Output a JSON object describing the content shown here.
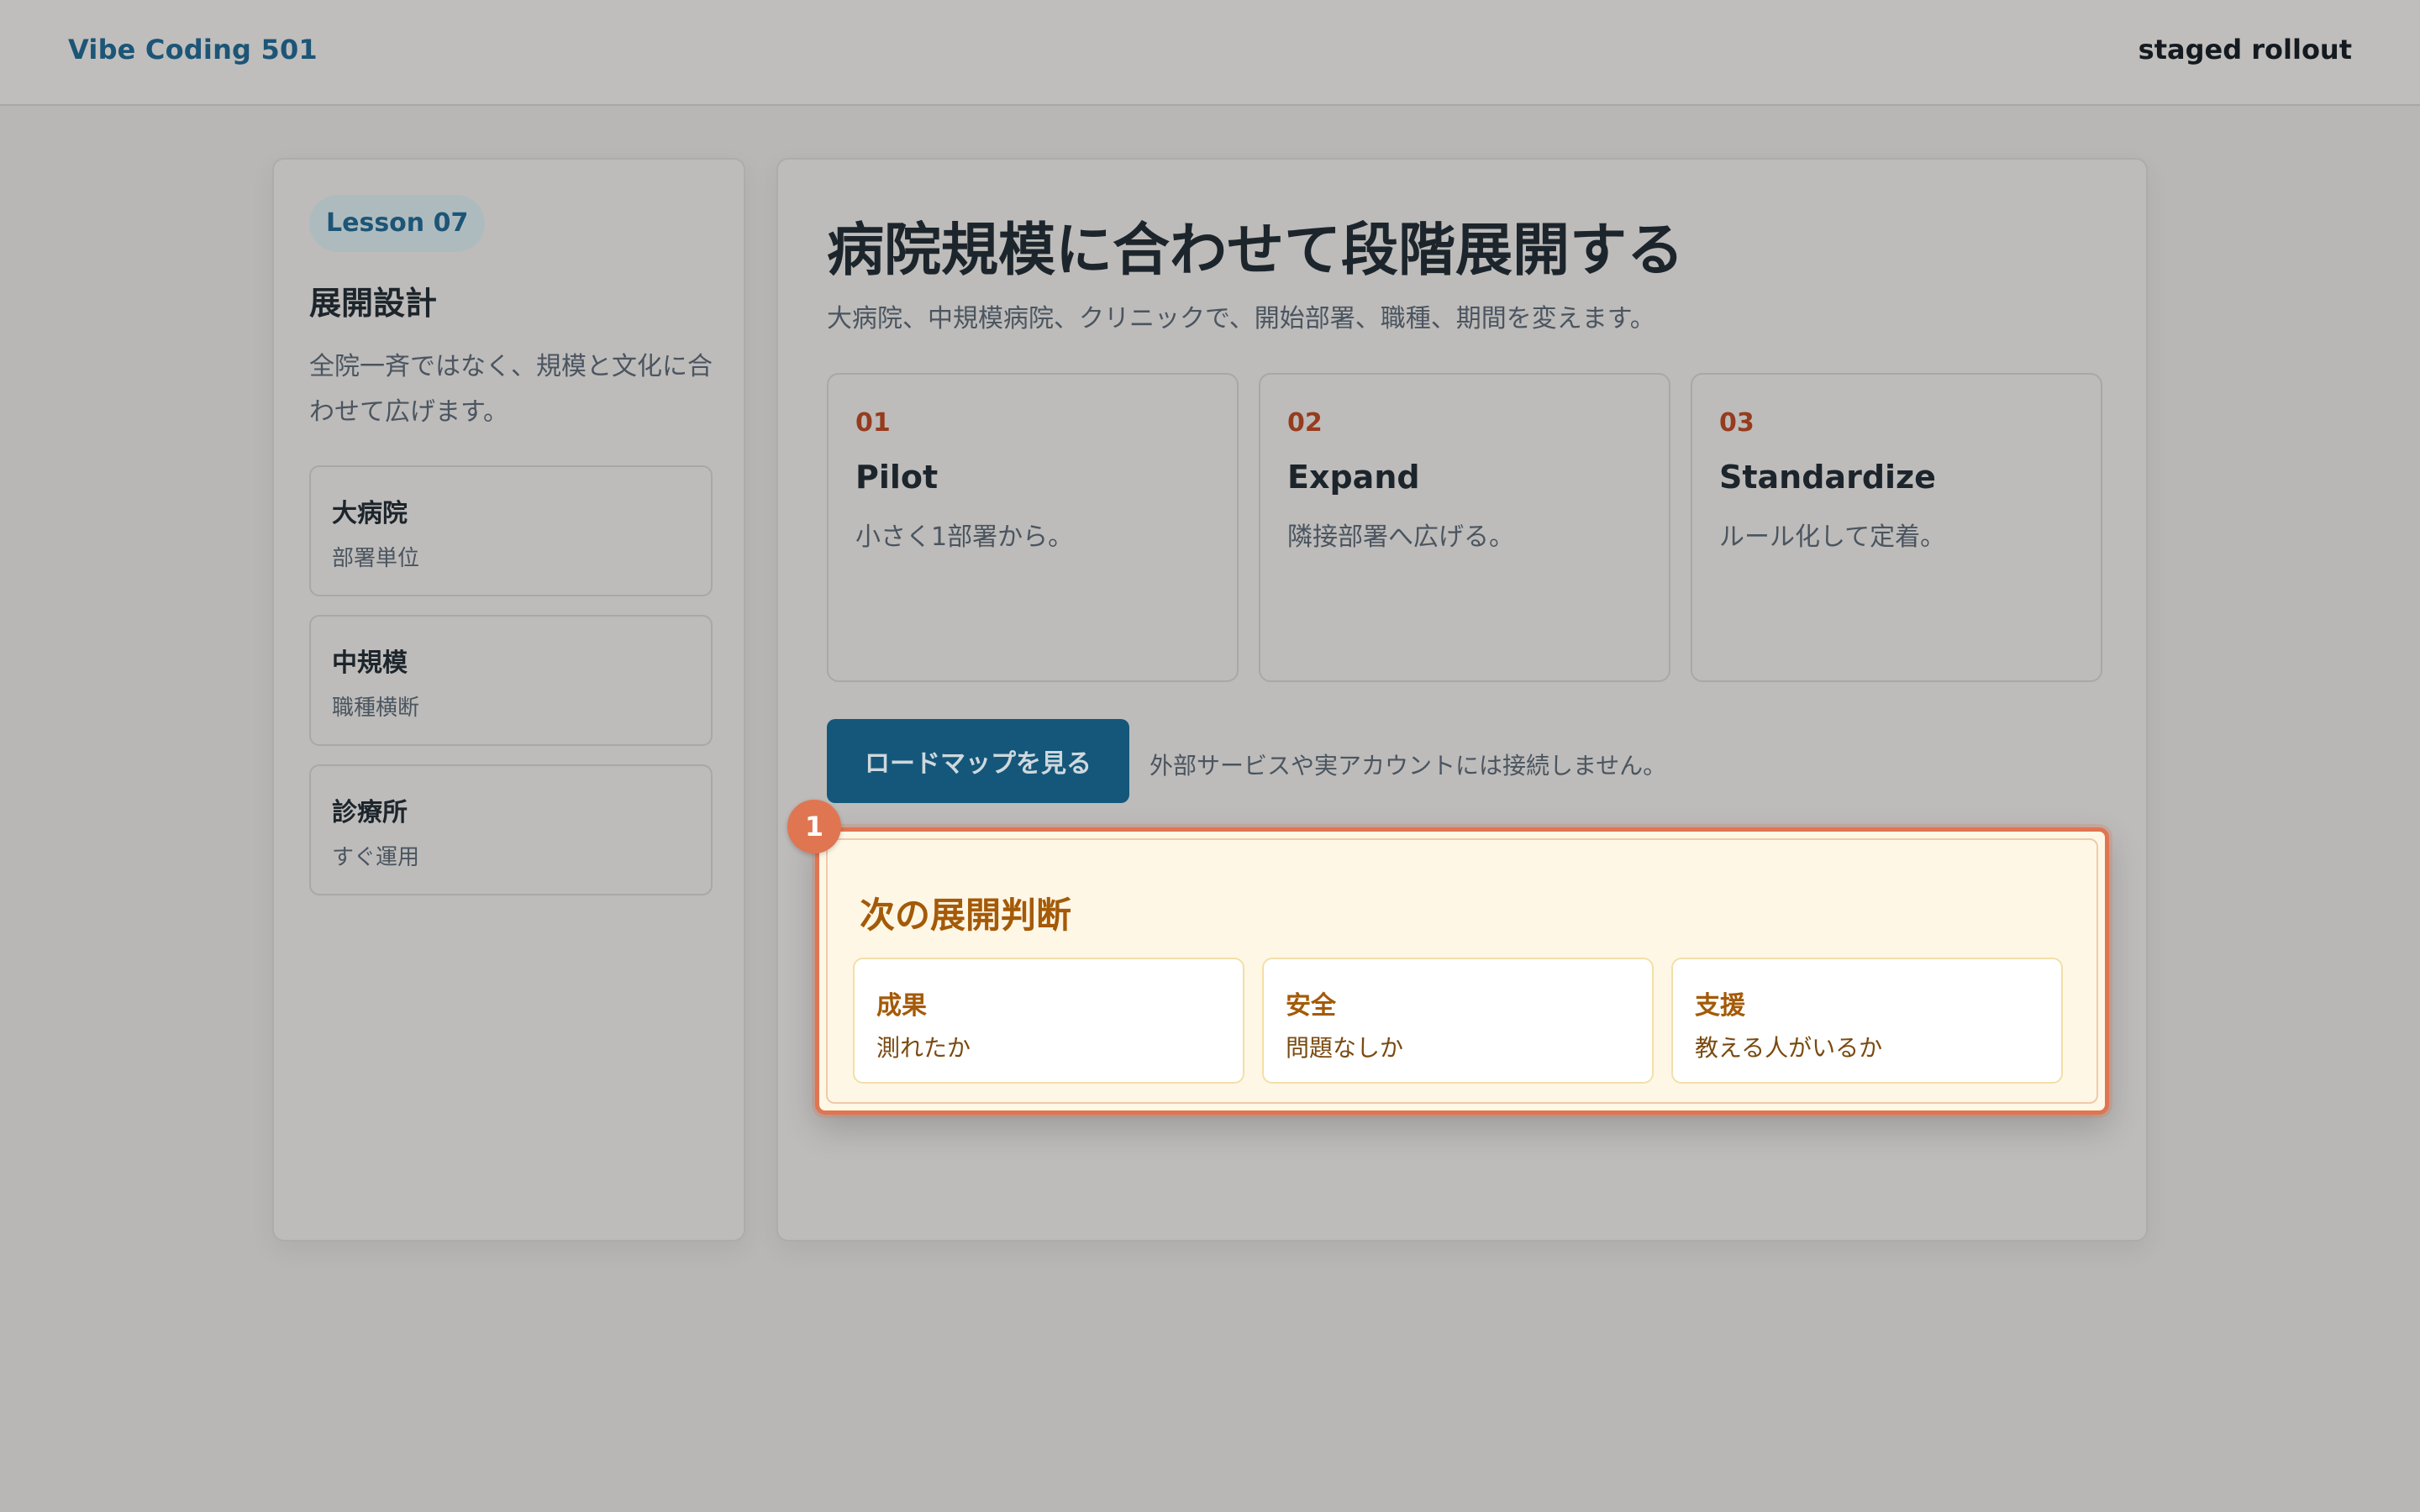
{
  "header": {
    "brand": "Vibe Coding 501",
    "right_label": "staged rollout"
  },
  "sidebar": {
    "badge": "Lesson 07",
    "title": "展開設計",
    "description": "全院一斉ではなく、規模と文化に合わせて広げます。",
    "items": [
      {
        "title": "大病院",
        "subtitle": "部署単位"
      },
      {
        "title": "中規模",
        "subtitle": "職種横断"
      },
      {
        "title": "診療所",
        "subtitle": "すぐ運用"
      }
    ]
  },
  "main": {
    "title": "病院規模に合わせて段階展開する",
    "subtitle": "大病院、中規模病院、クリニックで、開始部署、職種、期間を変えます。",
    "steps": [
      {
        "num": "01",
        "name": "Pilot",
        "desc": "小さく1部署から。"
      },
      {
        "num": "02",
        "name": "Expand",
        "desc": "隣接部署へ広げる。"
      },
      {
        "num": "03",
        "name": "Standardize",
        "desc": "ルール化して定着。"
      }
    ],
    "button_label": "ロードマップを見る",
    "note": "外部サービスや実アカウントには接続しません。"
  },
  "decision": {
    "marker": "1",
    "title": "次の展開判断",
    "items": [
      {
        "title": "成果",
        "subtitle": "測れたか"
      },
      {
        "title": "安全",
        "subtitle": "問題なしか"
      },
      {
        "title": "支援",
        "subtitle": "教える人がいるか"
      }
    ]
  },
  "colors": {
    "brand": "#1c5577",
    "accent": "#963c1e",
    "button": "#14577a",
    "highlight": "#e07551",
    "decision_text": "#a45a07"
  }
}
